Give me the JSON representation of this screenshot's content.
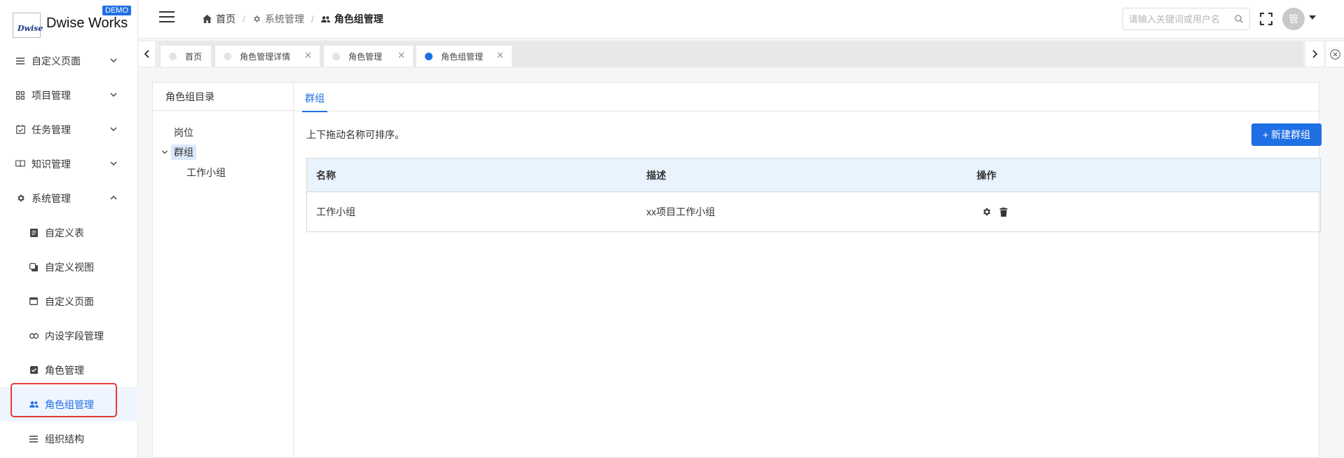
{
  "brand": {
    "logo_mark": "Dwise",
    "name": "Dwise Works",
    "badge": "DEMO"
  },
  "sidebar": {
    "items": [
      {
        "label": "自定义页面",
        "icon": "list-icon"
      },
      {
        "label": "项目管理",
        "icon": "grid-icon"
      },
      {
        "label": "任务管理",
        "icon": "calendar-check-icon"
      },
      {
        "label": "知识管理",
        "icon": "book-icon"
      },
      {
        "label": "系统管理",
        "icon": "gear-icon"
      },
      {
        "label": "自定义表",
        "icon": "document-icon"
      },
      {
        "label": "自定义视图",
        "icon": "layers-icon"
      },
      {
        "label": "自定义页面",
        "icon": "window-icon"
      },
      {
        "label": "内设字段管理",
        "icon": "link-icon"
      },
      {
        "label": "角色管理",
        "icon": "checkbox-icon"
      },
      {
        "label": "角色组管理",
        "icon": "people-icon"
      },
      {
        "label": "组织结构",
        "icon": "list-icon"
      }
    ]
  },
  "header": {
    "breadcrumb": [
      "首页",
      "系统管理",
      "角色组管理"
    ],
    "search_placeholder": "请输入关键词或用户名",
    "avatar_text": "管"
  },
  "tabs": [
    {
      "label": "首页",
      "active": false,
      "closable": false
    },
    {
      "label": "角色管理详情",
      "active": false,
      "closable": true
    },
    {
      "label": "角色管理",
      "active": false,
      "closable": true
    },
    {
      "label": "角色组管理",
      "active": true,
      "closable": true
    }
  ],
  "tree": {
    "title": "角色组目录",
    "nodes": [
      {
        "label": "岗位"
      },
      {
        "label": "群组"
      },
      {
        "label": "工作小组"
      }
    ]
  },
  "content": {
    "tab": "群组",
    "hint": "上下拖动名称可排序。",
    "new_button": "+ 新建群组",
    "columns": [
      "名称",
      "描述",
      "操作"
    ],
    "rows": [
      {
        "name": "工作小组",
        "desc": "xx项目工作小组"
      }
    ]
  },
  "colors": {
    "accent": "#1f6fe5",
    "highlight": "#e33b3b",
    "table_header": "#e8f3fd"
  }
}
